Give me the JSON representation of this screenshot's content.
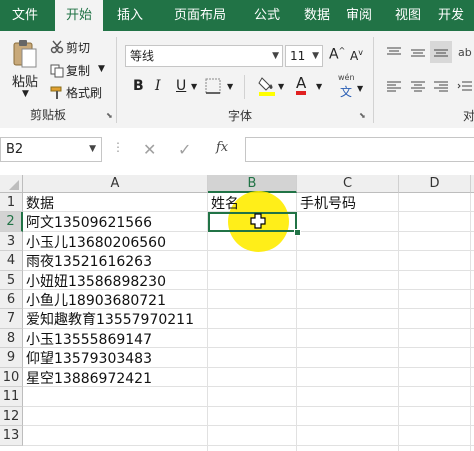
{
  "tabs": [
    {
      "label": "文件"
    },
    {
      "label": "开始"
    },
    {
      "label": "插入"
    },
    {
      "label": "页面布局"
    },
    {
      "label": "公式"
    },
    {
      "label": "数据"
    },
    {
      "label": "审阅"
    },
    {
      "label": "视图"
    },
    {
      "label": "开发"
    }
  ],
  "active_tab": "开始",
  "clipboard": {
    "paste_label": "粘贴",
    "cut_label": "剪切",
    "copy_label": "复制",
    "format_painter_label": "格式刷",
    "group_label": "剪贴板"
  },
  "font": {
    "name": "等线",
    "size": "11",
    "grow_label": "A",
    "shrink_label": "A",
    "bold_label": "B",
    "italic_label": "I",
    "underline_label": "U",
    "font_color_label": "A",
    "phonetic_label": "文",
    "phonetic_top": "wén",
    "group_label": "字体"
  },
  "alignment": {
    "group_label": "对"
  },
  "formula_bar": {
    "name_box": "B2",
    "fx_label": "fx",
    "content": ""
  },
  "columns": [
    "A",
    "B",
    "C",
    "D",
    "E"
  ],
  "rows": [
    "1",
    "2",
    "3",
    "4",
    "5",
    "6",
    "7",
    "8",
    "9",
    "10",
    "11",
    "12",
    "13"
  ],
  "selected_cell": "B2",
  "cells": {
    "A": [
      "数据",
      "阿文13509621566",
      "小玉儿13680206560",
      "雨夜13521616263",
      "小妞妞13586898230",
      "小鱼儿18903680721",
      "爱知趣教育13557970211",
      "小玉13555869147",
      "仰望13579303483",
      "星空13886972421"
    ],
    "B1": "姓名",
    "C1": "手机号码"
  },
  "colors": {
    "accent": "#217346",
    "highlight": "#ffec00"
  }
}
